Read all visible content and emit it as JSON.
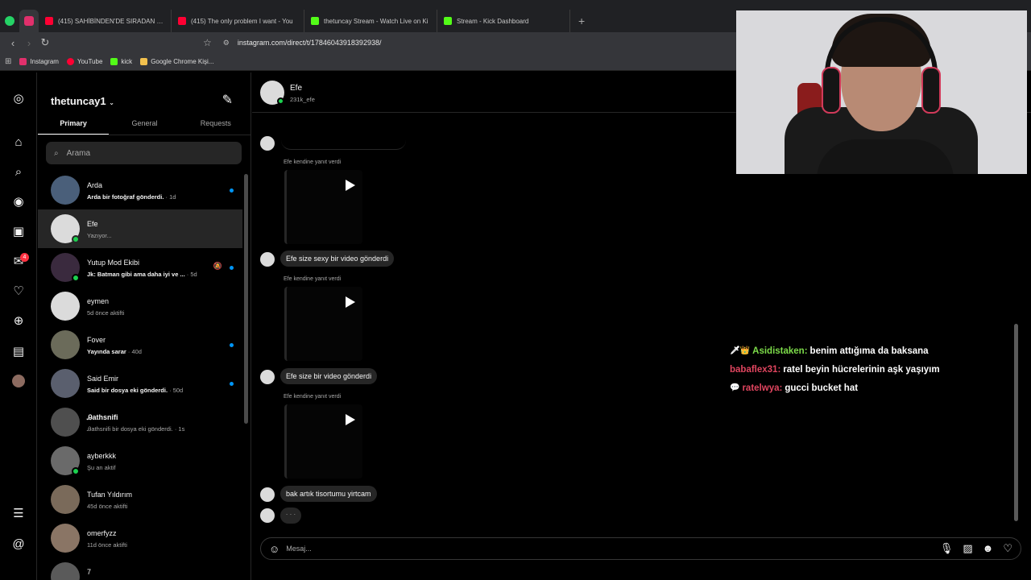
{
  "browser": {
    "tabs": [
      {
        "label": "(415) SAHİBİNDEN'DE SIRADAN BİR İ",
        "color": "#ff0033"
      },
      {
        "label": "(415) The only problem I want - You",
        "color": "#ff0033"
      },
      {
        "label": "thetuncay Stream - Watch Live on Ki",
        "color": "#53fc18"
      },
      {
        "label": "Stream - Kick Dashboard",
        "color": "#53fc18"
      }
    ],
    "new_tab": "+",
    "url": "instagram.com/direct/t/17846043918392938/",
    "bookmarks": [
      {
        "label": "Instagram",
        "color": "#e1306c"
      },
      {
        "label": "YouTube",
        "color": "#ff0033"
      },
      {
        "label": "kick",
        "color": "#53fc18"
      },
      {
        "label": "Google Chrome Kişi...",
        "color": "#f2c14e"
      }
    ]
  },
  "rail": {
    "icons": [
      "instagram-icon",
      "home-icon",
      "search-icon",
      "explore-icon",
      "reels-icon",
      "messages-icon",
      "notifications-icon",
      "create-icon",
      "dashboard-icon",
      "profile-icon",
      "menu-icon",
      "threads-icon"
    ],
    "messages_badge": "4"
  },
  "inbox": {
    "username": "thetuncay1",
    "tabs": [
      "Primary",
      "General",
      "Requests"
    ],
    "search_placeholder": "Arama",
    "conversations": [
      {
        "name": "Arda",
        "sub_bold": "Arda bir fotoğraf gönderdi.",
        "sub": " · 1d"
      },
      {
        "name": "Efe",
        "sub_bold": "",
        "sub": "Yazıyor..."
      },
      {
        "name": "Yutup Mod Ekibi",
        "sub_bold": "Jk: Batman gibi ama daha iyi ve ...",
        "sub": " · 5d"
      },
      {
        "name": "eymen",
        "sub_bold": "",
        "sub": "5d önce aktifti"
      },
      {
        "name": "Fover",
        "sub_bold": "Yayında sarar",
        "sub": " · 40d"
      },
      {
        "name": "Said Emir",
        "sub_bold": "Said bir dosya eki gönderdi.",
        "sub": " · 50d"
      },
      {
        "name": "Ꭿathsnifi",
        "sub_bold": "",
        "sub": "Ꭿathsnifi bir dosya eki gönderdi. · 1s"
      },
      {
        "name": "ayberkkk",
        "sub_bold": "",
        "sub": "Şu an aktif"
      },
      {
        "name": "Tufan Yıldırım",
        "sub_bold": "",
        "sub": "45d önce aktifti"
      },
      {
        "name": "omerfyzz",
        "sub_bold": "",
        "sub": "11d önce aktifti"
      },
      {
        "name": "7",
        "sub_bold": "",
        "sub": ""
      }
    ]
  },
  "chat": {
    "name": "Efe",
    "handle": "231k_efe",
    "reply_note": "Efe kendine yanıt verdi",
    "messages": [
      "Efe size sexy bir video gönderdi",
      "Efe size bir video gönderdi",
      "bak artık tisortumu yirtcam"
    ],
    "typing": "· · ·",
    "composer_placeholder": "Mesaj..."
  },
  "stream_chat": [
    {
      "user": "Asidistaken:",
      "text": "benim attığıma da baksana",
      "color": "#7ddc4a",
      "badges": "🗡👑"
    },
    {
      "user": "babaflex31:",
      "text": "ratel beyin hücrelerinin aşk yaşıyım",
      "color": "#e0455f",
      "badges": ""
    },
    {
      "user": "ratelwya:",
      "text": "gucci bucket hat",
      "color": "#e0455f",
      "badges": "💬"
    }
  ]
}
